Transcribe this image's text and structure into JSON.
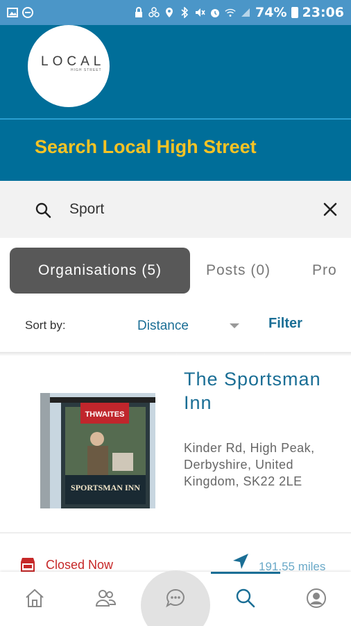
{
  "status_bar": {
    "battery": "74%",
    "time": "23:06",
    "icons": [
      "image-icon",
      "minus-circle-icon",
      "lock-icon",
      "recycle-icon",
      "location-icon",
      "bluetooth-icon",
      "mute-icon",
      "alarm-icon",
      "wifi-icon",
      "signal-icon",
      "battery-icon"
    ]
  },
  "header": {
    "logo_text": "LOCAL",
    "logo_subtext": "HIGH STREET",
    "title": "Search Local High Street"
  },
  "search": {
    "value": "Sport",
    "placeholder": ""
  },
  "tabs": [
    {
      "label": "Organisations (5)",
      "active": true
    },
    {
      "label": "Posts (0)",
      "active": false
    },
    {
      "label": "Pro",
      "active": false
    }
  ],
  "sort": {
    "label": "Sort by:",
    "selected": "Distance",
    "filter_label": "Filter"
  },
  "results": [
    {
      "title": "The Sportsman Inn",
      "address": "Kinder Rd, High Peak, Derbyshire, United Kingdom, SK22 2LE",
      "sign_brand": "THWAITES",
      "sign_name": "SPORTSMAN INN",
      "status": "Closed Now",
      "distance": "191.55 miles"
    }
  ],
  "colors": {
    "status_bar": "#4b96c8",
    "header": "#006e99",
    "title_yellow": "#f6c324",
    "accent_blue": "#1a6e95",
    "closed_red": "#c62828",
    "tab_active": "#585858"
  },
  "bottom_nav": [
    {
      "icon": "home-icon",
      "active": false
    },
    {
      "icon": "people-icon",
      "active": false
    },
    {
      "icon": "chat-icon",
      "active": false
    },
    {
      "icon": "search-icon",
      "active": true
    },
    {
      "icon": "account-icon",
      "active": false
    }
  ]
}
